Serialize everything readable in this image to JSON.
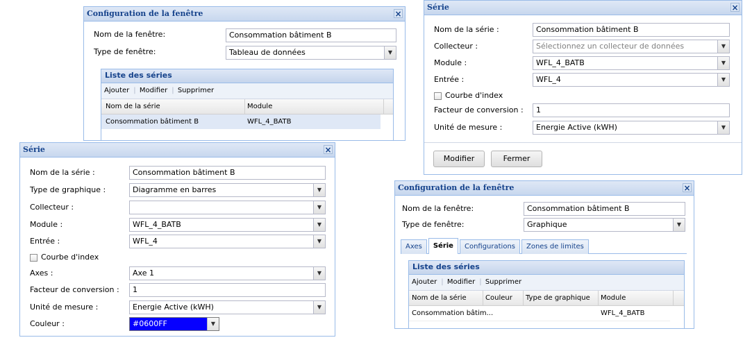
{
  "win1": {
    "title": "Configuration de la fenêtre",
    "close": "×",
    "name_label": "Nom de la fenêtre:",
    "name_value": "Consommation bâtiment B",
    "type_label": "Type de fenêtre:",
    "type_value": "Tableau de données",
    "series_panel_title": "Liste des séries",
    "toolbar": {
      "add": "Ajouter",
      "edit": "Modifier",
      "delete": "Supprimer"
    },
    "columns": [
      "Nom de la série",
      "Module"
    ],
    "rows": [
      [
        "Consommation bâtiment B",
        "WFL_4_BATB"
      ]
    ]
  },
  "win2": {
    "title": "Série",
    "close": "×",
    "name_label": "Nom de la série :",
    "name_value": "Consommation bâtiment B",
    "collector_label": "Collecteur :",
    "collector_placeholder": "Sélectionnez un collecteur de données",
    "module_label": "Module :",
    "module_value": "WFL_4_BATB",
    "input_label": "Entrée :",
    "input_value": "WFL_4",
    "index_curve_label": "Courbe d'index",
    "factor_label": "Facteur de conversion :",
    "factor_value": "1",
    "unit_label": "Unité de mesure :",
    "unit_value": "Energie Active (kWH)",
    "btn_modify": "Modifier",
    "btn_close": "Fermer"
  },
  "win3": {
    "title": "Série",
    "close": "×",
    "name_label": "Nom de la série :",
    "name_value": "Consommation bâtiment B",
    "chart_type_label": "Type de graphique :",
    "chart_type_value": "Diagramme en barres",
    "collector_label": "Collecteur :",
    "collector_value": "",
    "module_label": "Module :",
    "module_value": "WFL_4_BATB",
    "input_label": "Entrée :",
    "input_value": "WFL_4",
    "index_curve_label": "Courbe d'index",
    "axes_label": "Axes :",
    "axes_value": "Axe 1",
    "factor_label": "Facteur de conversion :",
    "factor_value": "1",
    "unit_label": "Unité de mesure :",
    "unit_value": "Energie Active (kWH)",
    "color_label": "Couleur :",
    "color_value": "#0600FF"
  },
  "win4": {
    "title": "Configuration de la fenêtre",
    "close": "×",
    "name_label": "Nom de la fenêtre:",
    "name_value": "Consommation bâtiment B",
    "type_label": "Type de fenêtre:",
    "type_value": "Graphique",
    "tabs": [
      "Axes",
      "Série",
      "Configurations",
      "Zones de limites"
    ],
    "series_panel_title": "Liste des séries",
    "toolbar": {
      "add": "Ajouter",
      "edit": "Modifier",
      "delete": "Supprimer"
    },
    "columns": [
      "Nom de la série",
      "Couleur",
      "Type de graphique",
      "Module"
    ],
    "rows": [
      [
        "Consommation bâtim...",
        "",
        "",
        "WFL_4_BATB"
      ]
    ]
  },
  "colors": {
    "title_text": "#15428b",
    "border": "#99bbe8",
    "selection": "#dfe8f6",
    "swatch": "#0600FF"
  },
  "icons": {
    "close": "close-icon",
    "combo": "chevron-down-icon",
    "checkbox": "checkbox-icon"
  }
}
